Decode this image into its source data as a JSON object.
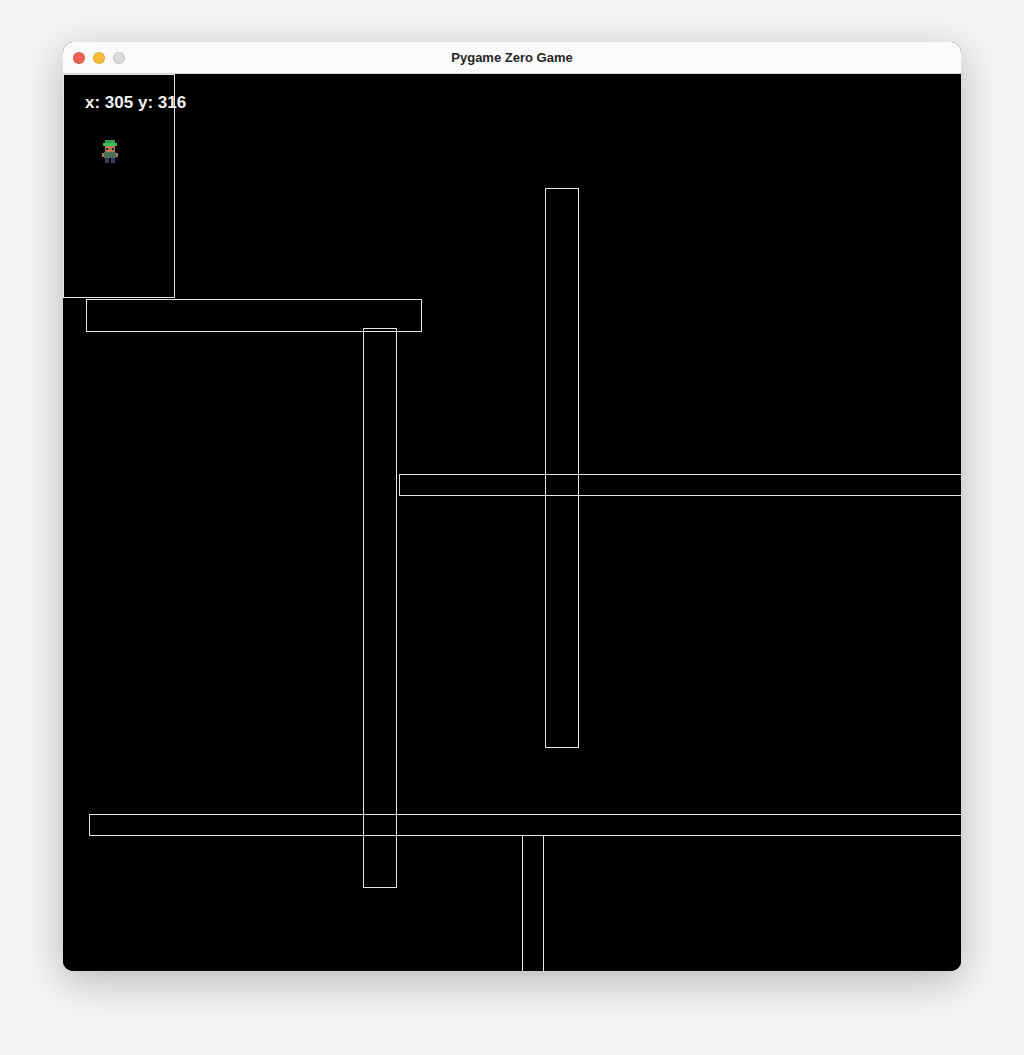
{
  "window": {
    "title": "Pygame Zero Game",
    "controls": [
      {
        "disabled": false,
        "color": "#ee5f57"
      },
      {
        "disabled": false,
        "color": "#f6bd3b"
      },
      {
        "disabled": true,
        "color": "#dcdcdc"
      }
    ]
  },
  "hud": {
    "text": "x: 305 y: 316"
  }
}
